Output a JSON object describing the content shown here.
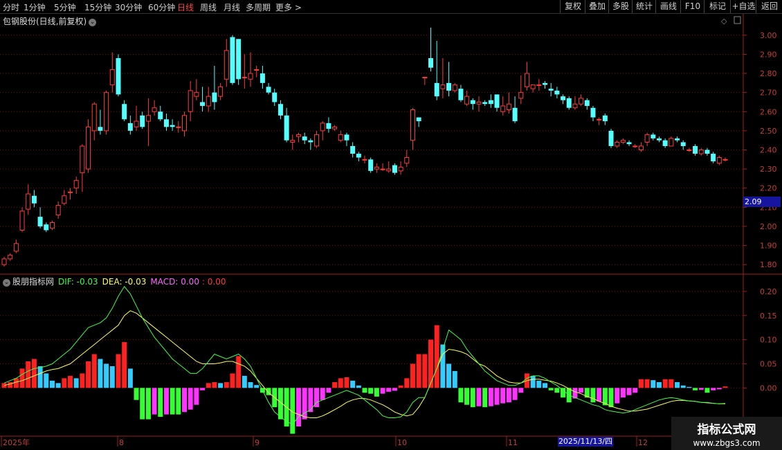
{
  "toolbar": {
    "periods": [
      {
        "label": "分时",
        "active": false
      },
      {
        "label": "1分钟",
        "active": false
      },
      {
        "label": "5分钟",
        "active": false
      },
      {
        "label": "15分钟",
        "active": false
      },
      {
        "label": "30分钟",
        "active": false
      },
      {
        "label": "60分钟",
        "active": false
      },
      {
        "label": "日线",
        "active": true
      },
      {
        "label": "周线",
        "active": false
      },
      {
        "label": "月线",
        "active": false
      },
      {
        "label": "多周期",
        "active": false
      },
      {
        "label": "更多 >",
        "active": false
      }
    ],
    "right_buttons": [
      "复权",
      "叠加",
      "多股",
      "统计",
      "画线",
      "F10",
      "标记",
      "+自选",
      "返回"
    ]
  },
  "chart_title": "包钢股份(日线,前复权)",
  "indicator": {
    "name": "股朋指标网",
    "dif_label": "DIF: -0.03",
    "dea_label": "DEA: -0.03",
    "macd_label": "MACD: 0.00",
    "macd_extra": ": 0.00"
  },
  "current_price": "2.09",
  "cursor_date": "2025/11/13/四",
  "month_labels": [
    "2025年",
    "8",
    "9",
    "10",
    "11",
    "12"
  ],
  "watermark": {
    "title": "指标公式网",
    "url": "www.zbgs3.com"
  },
  "colors": {
    "up": "#ff3c3c",
    "down": "#54ffff",
    "dif": "#ffff55",
    "dea": "#40ff40",
    "neg_bar_a": "#33ff33",
    "neg_bar_b": "#ff33ff",
    "pos_bar": "#ff2020",
    "pos_bar_b": "#33ccff",
    "grid": "#801010",
    "frame": "#a02020"
  },
  "chart_data": {
    "type": "candlestick",
    "price_axis": {
      "ticks": [
        "3.00",
        "2.90",
        "2.80",
        "2.70",
        "2.60",
        "2.50",
        "2.40",
        "2.30",
        "2.20",
        "2.10",
        "2.00",
        "1.90",
        "1.80"
      ],
      "min": 1.75,
      "max": 3.05
    },
    "candles": [
      [
        1.8,
        1.83,
        1.79,
        1.84
      ],
      [
        1.83,
        1.85,
        1.82,
        1.86
      ],
      [
        1.87,
        1.91,
        1.86,
        1.93
      ],
      [
        1.98,
        2.08,
        1.97,
        2.1
      ],
      [
        2.09,
        2.17,
        2.06,
        2.22
      ],
      [
        2.16,
        2.12,
        2.1,
        2.19
      ],
      [
        2.05,
        2.0,
        1.99,
        2.1
      ],
      [
        2.01,
        1.98,
        1.97,
        2.02
      ],
      [
        1.99,
        2.02,
        1.98,
        2.03
      ],
      [
        2.06,
        2.11,
        2.04,
        2.13
      ],
      [
        2.12,
        2.16,
        2.11,
        2.19
      ],
      [
        2.18,
        2.18,
        2.14,
        2.2
      ],
      [
        2.2,
        2.24,
        2.17,
        2.26
      ],
      [
        2.28,
        2.42,
        2.18,
        2.43
      ],
      [
        2.3,
        2.52,
        2.28,
        2.56
      ],
      [
        2.5,
        2.64,
        2.45,
        2.65
      ],
      [
        2.52,
        2.5,
        2.48,
        2.61
      ],
      [
        2.5,
        2.7,
        2.48,
        2.71
      ],
      [
        2.74,
        2.82,
        2.7,
        2.91
      ],
      [
        2.88,
        2.69,
        2.68,
        2.9
      ],
      [
        2.64,
        2.56,
        2.55,
        2.66
      ],
      [
        2.54,
        2.5,
        2.48,
        2.58
      ],
      [
        2.52,
        2.55,
        2.5,
        2.63
      ],
      [
        2.58,
        2.52,
        2.51,
        2.6
      ],
      [
        2.55,
        2.58,
        2.42,
        2.67
      ],
      [
        2.6,
        2.62,
        2.58,
        2.66
      ],
      [
        2.6,
        2.56,
        2.55,
        2.63
      ],
      [
        2.56,
        2.52,
        2.5,
        2.59
      ],
      [
        2.53,
        2.52,
        2.5,
        2.56
      ],
      [
        2.52,
        2.52,
        2.49,
        2.55
      ],
      [
        2.5,
        2.58,
        2.47,
        2.6
      ],
      [
        2.6,
        2.71,
        2.55,
        2.76
      ],
      [
        2.68,
        2.7,
        2.66,
        2.77
      ],
      [
        2.65,
        2.63,
        2.6,
        2.73
      ],
      [
        2.63,
        2.68,
        2.6,
        2.73
      ],
      [
        2.7,
        2.65,
        2.61,
        2.84
      ],
      [
        2.68,
        2.73,
        2.66,
        2.75
      ],
      [
        2.77,
        2.92,
        2.73,
        2.98
      ],
      [
        2.99,
        2.75,
        2.74,
        3.0
      ],
      [
        2.98,
        2.77,
        2.74,
        2.98
      ],
      [
        2.78,
        2.78,
        2.72,
        2.9
      ],
      [
        2.77,
        2.8,
        2.73,
        2.91
      ],
      [
        2.82,
        2.82,
        2.78,
        2.84
      ],
      [
        2.8,
        2.75,
        2.72,
        2.84
      ],
      [
        2.73,
        2.7,
        2.69,
        2.75
      ],
      [
        2.7,
        2.65,
        2.63,
        2.72
      ],
      [
        2.64,
        2.58,
        2.56,
        2.66
      ],
      [
        2.58,
        2.45,
        2.44,
        2.62
      ],
      [
        2.44,
        2.45,
        2.4,
        2.48
      ],
      [
        2.47,
        2.48,
        2.44,
        2.49
      ],
      [
        2.47,
        2.45,
        2.43,
        2.49
      ],
      [
        2.45,
        2.44,
        2.4,
        2.46
      ],
      [
        2.42,
        2.48,
        2.41,
        2.5
      ],
      [
        2.5,
        2.54,
        2.45,
        2.55
      ],
      [
        2.54,
        2.51,
        2.49,
        2.57
      ],
      [
        2.51,
        2.52,
        2.5,
        2.53
      ],
      [
        2.45,
        2.48,
        2.44,
        2.5
      ],
      [
        2.48,
        2.45,
        2.42,
        2.49
      ],
      [
        2.42,
        2.38,
        2.36,
        2.44
      ],
      [
        2.38,
        2.36,
        2.34,
        2.39
      ],
      [
        2.35,
        2.35,
        2.33,
        2.37
      ],
      [
        2.35,
        2.29,
        2.28,
        2.36
      ],
      [
        2.3,
        2.31,
        2.28,
        2.33
      ],
      [
        2.3,
        2.3,
        2.29,
        2.33
      ],
      [
        2.29,
        2.3,
        2.28,
        2.34
      ],
      [
        2.32,
        2.28,
        2.27,
        2.33
      ],
      [
        2.29,
        2.31,
        2.27,
        2.34
      ],
      [
        2.33,
        2.36,
        2.31,
        2.4
      ],
      [
        2.45,
        2.61,
        2.4,
        2.62
      ],
      [
        2.57,
        2.55,
        2.52,
        2.57
      ],
      [
        2.78,
        2.78,
        2.74,
        2.78
      ],
      [
        2.88,
        2.83,
        2.81,
        3.04
      ],
      [
        2.75,
        2.68,
        2.66,
        2.97
      ],
      [
        2.72,
        2.74,
        2.67,
        2.88
      ],
      [
        2.75,
        2.71,
        2.68,
        2.86
      ],
      [
        2.71,
        2.74,
        2.7,
        2.75
      ],
      [
        2.72,
        2.66,
        2.65,
        2.74
      ],
      [
        2.64,
        2.68,
        2.63,
        2.71
      ],
      [
        2.66,
        2.64,
        2.61,
        2.67
      ],
      [
        2.64,
        2.65,
        2.6,
        2.68
      ],
      [
        2.65,
        2.64,
        2.63,
        2.66
      ],
      [
        2.66,
        2.64,
        2.62,
        2.69
      ],
      [
        2.69,
        2.62,
        2.6,
        2.69
      ],
      [
        2.6,
        2.63,
        2.58,
        2.68
      ],
      [
        2.61,
        2.64,
        2.59,
        2.7
      ],
      [
        2.62,
        2.55,
        2.54,
        2.68
      ],
      [
        2.67,
        2.7,
        2.64,
        2.79
      ],
      [
        2.73,
        2.8,
        2.71,
        2.86
      ],
      [
        2.72,
        2.74,
        2.7,
        2.74
      ],
      [
        2.74,
        2.74,
        2.71,
        2.77
      ],
      [
        2.75,
        2.74,
        2.72,
        2.76
      ],
      [
        2.72,
        2.71,
        2.68,
        2.75
      ],
      [
        2.71,
        2.69,
        2.67,
        2.73
      ],
      [
        2.68,
        2.66,
        2.64,
        2.69
      ],
      [
        2.67,
        2.62,
        2.61,
        2.68
      ],
      [
        2.62,
        2.64,
        2.61,
        2.68
      ],
      [
        2.64,
        2.67,
        2.63,
        2.69
      ],
      [
        2.66,
        2.63,
        2.61,
        2.67
      ],
      [
        2.62,
        2.57,
        2.55,
        2.63
      ],
      [
        2.56,
        2.56,
        2.53,
        2.57
      ],
      [
        2.58,
        2.55,
        2.53,
        2.59
      ],
      [
        2.5,
        2.42,
        2.41,
        2.51
      ],
      [
        2.42,
        2.44,
        2.41,
        2.45
      ],
      [
        2.44,
        2.45,
        2.43,
        2.46
      ],
      [
        2.44,
        2.43,
        2.42,
        2.45
      ],
      [
        2.42,
        2.42,
        2.41,
        2.43
      ],
      [
        2.4,
        2.42,
        2.39,
        2.44
      ],
      [
        2.44,
        2.48,
        2.42,
        2.49
      ],
      [
        2.48,
        2.46,
        2.45,
        2.49
      ],
      [
        2.46,
        2.45,
        2.44,
        2.47
      ],
      [
        2.45,
        2.42,
        2.41,
        2.46
      ],
      [
        2.42,
        2.46,
        2.42,
        2.47
      ],
      [
        2.46,
        2.45,
        2.44,
        2.47
      ],
      [
        2.44,
        2.42,
        2.4,
        2.45
      ],
      [
        2.4,
        2.4,
        2.39,
        2.41
      ],
      [
        2.42,
        2.38,
        2.37,
        2.43
      ],
      [
        2.38,
        2.4,
        2.37,
        2.41
      ],
      [
        2.4,
        2.38,
        2.37,
        2.41
      ],
      [
        2.38,
        2.34,
        2.33,
        2.39
      ],
      [
        2.33,
        2.36,
        2.32,
        2.37
      ],
      [
        2.35,
        2.35,
        2.34,
        2.36
      ]
    ],
    "macd_axis": {
      "ticks": [
        "0.20",
        "0.15",
        "0.10",
        "0.05",
        "0.00"
      ],
      "min": -0.1,
      "max": 0.23
    },
    "macd": [
      0.01,
      0.012,
      0.02,
      0.04,
      0.055,
      0.06,
      0.045,
      0.03,
      0.015,
      0.01,
      0.02,
      0.025,
      0.02,
      0.03,
      0.055,
      0.07,
      0.06,
      0.05,
      0.045,
      0.07,
      0.095,
      0.04,
      -0.025,
      -0.065,
      -0.065,
      -0.055,
      -0.06,
      -0.055,
      -0.055,
      -0.055,
      -0.05,
      -0.045,
      -0.035,
      -0.005,
      0.01,
      0.012,
      0.01,
      0.012,
      0.03,
      0.066,
      0.025,
      0.012,
      0.006,
      -0.01,
      -0.015,
      -0.04,
      -0.065,
      -0.08,
      -0.095,
      -0.08,
      -0.065,
      -0.05,
      -0.04,
      -0.025,
      -0.01,
      0.012,
      0.02,
      0.022,
      0.015,
      0.005,
      -0.01,
      -0.012,
      -0.018,
      -0.012,
      -0.008,
      -0.006,
      0.005,
      0.02,
      0.05,
      0.07,
      0.07,
      0.1,
      0.13,
      0.09,
      0.05,
      0.035,
      -0.03,
      -0.035,
      -0.04,
      -0.038,
      -0.04,
      -0.038,
      -0.035,
      -0.032,
      -0.03,
      -0.025,
      -0.01,
      0.03,
      0.025,
      0.015,
      0.01,
      -0.005,
      -0.01,
      -0.02,
      -0.03,
      -0.022,
      -0.01,
      -0.02,
      -0.03,
      -0.028,
      -0.036,
      -0.04,
      -0.032,
      -0.02,
      -0.015,
      -0.01,
      0.018,
      0.018,
      0.016,
      0.012,
      0.018,
      0.018,
      0.012,
      0.005,
      0.002,
      -0.005,
      -0.004,
      -0.01,
      -0.005,
      -0.003,
      0.003
    ],
    "dif": [
      0.01,
      0.015,
      0.02,
      0.028,
      0.035,
      0.04,
      0.042,
      0.045,
      0.05,
      0.06,
      0.07,
      0.08,
      0.095,
      0.11,
      0.125,
      0.13,
      0.135,
      0.145,
      0.165,
      0.19,
      0.21,
      0.195,
      0.17,
      0.145,
      0.125,
      0.105,
      0.09,
      0.075,
      0.06,
      0.05,
      0.04,
      0.03,
      0.03,
      0.04,
      0.055,
      0.07,
      0.065,
      0.06,
      0.065,
      0.07,
      0.06,
      0.045,
      0.02,
      -0.005,
      -0.03,
      -0.05,
      -0.06,
      -0.07,
      -0.075,
      -0.06,
      -0.052,
      -0.045,
      -0.03,
      -0.025,
      -0.02,
      -0.015,
      -0.01,
      -0.005,
      -0.01,
      -0.015,
      -0.025,
      -0.035,
      -0.045,
      -0.058,
      -0.062,
      -0.062,
      -0.06,
      -0.05,
      -0.03,
      -0.02,
      -0.02,
      0.01,
      0.04,
      0.08,
      0.12,
      0.11,
      0.1,
      0.08,
      0.065,
      0.05,
      0.035,
      0.025,
      0.015,
      0.01,
      0.005,
      0.005,
      0.01,
      0.02,
      0.025,
      0.025,
      0.02,
      0.012,
      0.005,
      -0.005,
      -0.015,
      -0.02,
      -0.025,
      -0.03,
      -0.035,
      -0.038,
      -0.045,
      -0.048,
      -0.05,
      -0.052,
      -0.05,
      -0.045,
      -0.04,
      -0.035,
      -0.03,
      -0.025,
      -0.022,
      -0.02,
      -0.022,
      -0.025,
      -0.027,
      -0.028,
      -0.03,
      -0.03,
      -0.032,
      -0.033,
      -0.032
    ],
    "dea": [
      0.005,
      0.008,
      0.012,
      0.015,
      0.02,
      0.025,
      0.03,
      0.035,
      0.038,
      0.04,
      0.045,
      0.05,
      0.06,
      0.07,
      0.08,
      0.09,
      0.1,
      0.11,
      0.12,
      0.13,
      0.15,
      0.16,
      0.155,
      0.145,
      0.135,
      0.125,
      0.115,
      0.105,
      0.095,
      0.085,
      0.075,
      0.065,
      0.055,
      0.05,
      0.05,
      0.05,
      0.052,
      0.055,
      0.055,
      0.05,
      0.045,
      0.035,
      0.02,
      0.005,
      -0.01,
      -0.02,
      -0.03,
      -0.04,
      -0.05,
      -0.055,
      -0.06,
      -0.062,
      -0.062,
      -0.058,
      -0.052,
      -0.045,
      -0.038,
      -0.03,
      -0.025,
      -0.022,
      -0.022,
      -0.025,
      -0.03,
      -0.035,
      -0.042,
      -0.05,
      -0.055,
      -0.058,
      -0.055,
      -0.04,
      -0.02,
      0.01,
      0.04,
      0.07,
      0.08,
      0.078,
      0.075,
      0.07,
      0.06,
      0.05,
      0.045,
      0.035,
      0.025,
      0.018,
      0.012,
      0.01,
      0.01,
      0.015,
      0.018,
      0.018,
      0.016,
      0.014,
      0.01,
      0.005,
      -0.002,
      -0.008,
      -0.012,
      -0.018,
      -0.022,
      -0.028,
      -0.032,
      -0.038,
      -0.042,
      -0.045,
      -0.048,
      -0.048,
      -0.046,
      -0.044,
      -0.04,
      -0.036,
      -0.032,
      -0.028,
      -0.026,
      -0.026,
      -0.027,
      -0.028,
      -0.03,
      -0.031,
      -0.032,
      -0.033,
      -0.033
    ]
  }
}
